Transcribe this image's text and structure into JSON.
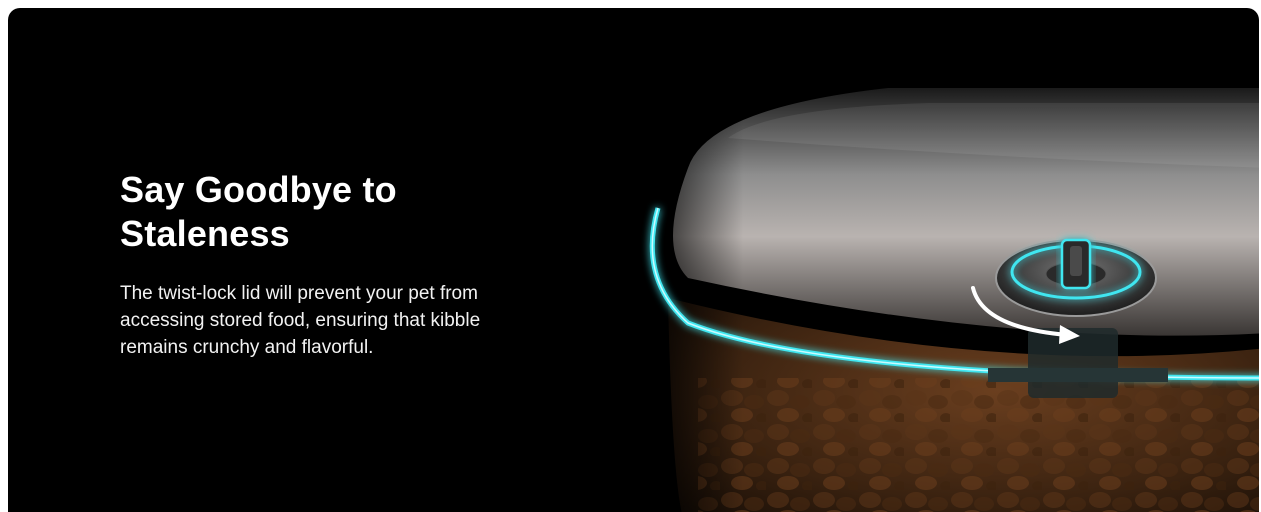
{
  "hero": {
    "headline": "Say Goodbye to Staleness",
    "description": "The twist-lock lid will prevent your pet from accessing stored food, ensuring that kibble remains crunchy and flavorful."
  },
  "colors": {
    "background": "#000000",
    "glow_accent": "#3fe6f0",
    "text": "#ffffff"
  },
  "visual": {
    "icon": "twist-lock-lid-product-illustration"
  }
}
